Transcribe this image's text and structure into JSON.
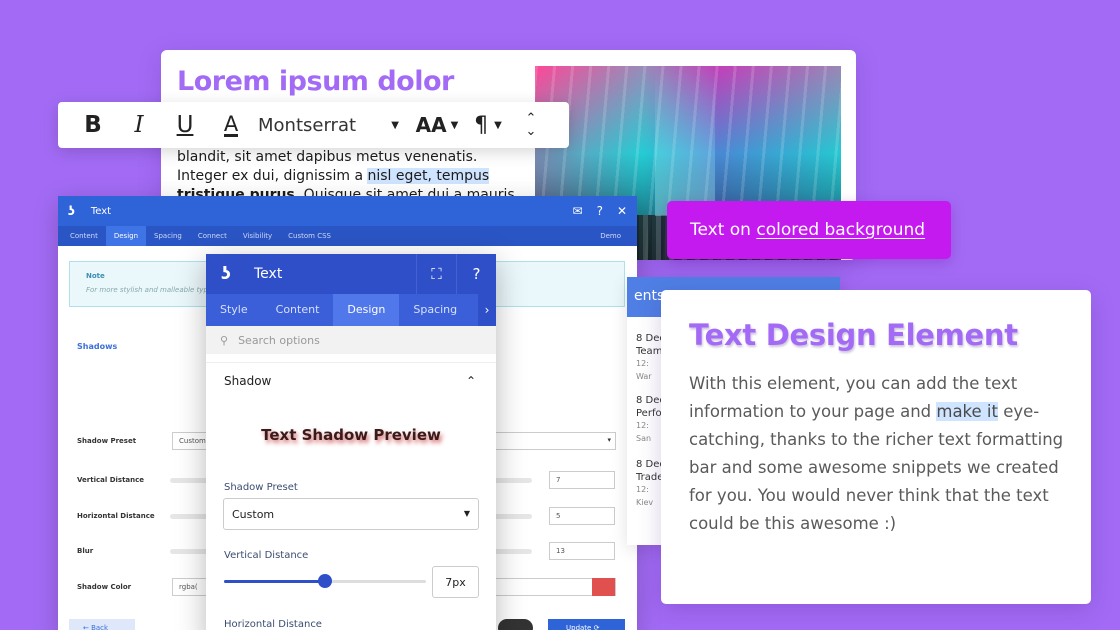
{
  "article": {
    "title": "Lorem ipsum dolor",
    "text_1": "blandit, sit amet dapibus metus venenatis. Integer ex dui, dignissim a ",
    "text_hl": "nisl eget, tempus",
    "text_2": " ",
    "text_bold": "tristique purus",
    "text_3": ". Quisque sit amet dui a mauris scelerisque"
  },
  "toolbar": {
    "bold": "B",
    "italic": "I",
    "underline": "U",
    "text_color": "A",
    "font": "Montserrat",
    "size_icon": "AA",
    "paragraph_icon": "¶"
  },
  "chip": {
    "prefix": "Text on ",
    "link": "colored background"
  },
  "admin": {
    "title": "Text",
    "tabs": [
      "Content",
      "Design",
      "Spacing",
      "Connect",
      "Visibility",
      "Custom CSS"
    ],
    "tab_right": "Demo",
    "note_title": "Note",
    "note_text": "For more stylish and malleable typograph",
    "section": "Shadows",
    "rows": [
      "Shadow Preset",
      "Vertical Distance",
      "Horizontal Distance",
      "Blur",
      "Shadow Color"
    ],
    "preset_value": "Custom",
    "vertical": "7",
    "horizontal": "5",
    "blur": "13",
    "color_value": "rgba(",
    "back": "← Back",
    "update": "Update ⟳",
    "color_swatch": "#e0504f"
  },
  "panel": {
    "title": "Text",
    "tabs": [
      "Style",
      "Content",
      "Design",
      "Spacing"
    ],
    "active_tab": "Design",
    "search_placeholder": "Search options",
    "section": "Shadow",
    "preview": "Text Shadow Preview",
    "preset_label": "Shadow Preset",
    "preset_value": "Custom",
    "vertical_label": "Vertical Distance",
    "vertical_value": "7px",
    "vertical_fraction": 0.5,
    "horizontal_label": "Horizontal Distance"
  },
  "peek": {
    "head": "ents",
    "items": [
      {
        "line1": "8 Dec",
        "line2": "Team",
        "line3": "12:",
        "line4": "War"
      },
      {
        "line1": "8 Dec",
        "line2": "Perfo",
        "line3": "12:",
        "line4": "San"
      },
      {
        "line1": "8 Dec",
        "line2": "Trade",
        "line3": "12:",
        "line4": "Kiev"
      }
    ]
  },
  "design_card": {
    "title": "Text Design Element",
    "body_1": "With this element, you can add the text information to your page and ",
    "body_hl": "make it",
    "body_2": " eye-catching, thanks to the richer text formatting bar and some awesome snippets we created for you. You would never think that the text could be this awesome :)"
  },
  "colors": {
    "background": "#a36bf5",
    "accent_purple": "#a36bf5",
    "chip_magenta": "#c41aef",
    "panel_blue": "#2f4fc9"
  }
}
